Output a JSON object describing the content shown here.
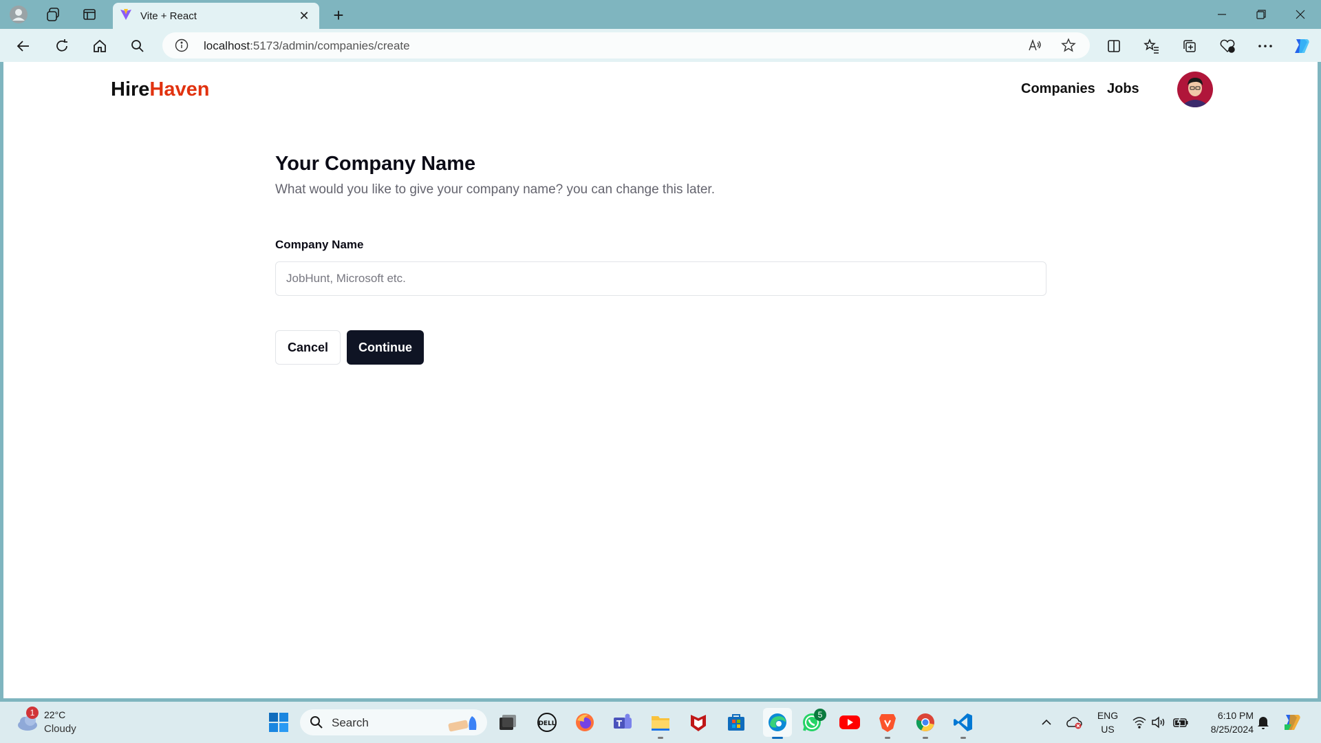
{
  "browser": {
    "tab_title": "Vite + React",
    "address_host": "localhost",
    "address_path": ":5173/admin/companies/create"
  },
  "app": {
    "brand_part1": "Hire",
    "brand_part2": "Haven",
    "nav": [
      {
        "label": "Companies"
      },
      {
        "label": "Jobs"
      }
    ]
  },
  "form": {
    "title": "Your Company Name",
    "subtitle": "What would you like to give your company name? you can change this later.",
    "company_label": "Company Name",
    "company_placeholder": "JobHunt, Microsoft etc.",
    "company_value": "",
    "cancel_label": "Cancel",
    "continue_label": "Continue"
  },
  "colors": {
    "brand_accent": "#e1320f",
    "primary_button": "#0f1424"
  },
  "taskbar": {
    "weather_badge": "1",
    "weather_temp": "22°C",
    "weather_condition": "Cloudy",
    "search_label": "Search",
    "whatsapp_badge": "5",
    "lang_line1": "ENG",
    "lang_line2": "US",
    "time": "6:10 PM",
    "date": "8/25/2024"
  }
}
